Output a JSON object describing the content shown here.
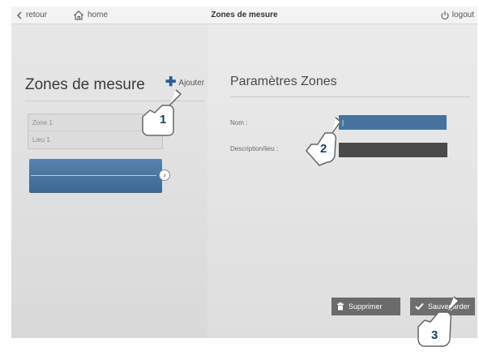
{
  "topbar": {
    "back_label": "retour",
    "home_label": "home",
    "title": "Zones de mesure",
    "logout_label": "logout"
  },
  "left": {
    "heading": "Zones de mesure",
    "add_label": "Ajouter",
    "zone": {
      "name": "Zone 1",
      "place": "Lieu 1"
    }
  },
  "right": {
    "heading": "Paramètres Zones",
    "nom_label": "Nom :",
    "nom_value": "|",
    "desc_label": "Description/lieu :",
    "desc_value": "",
    "delete_label": "Supprimer",
    "save_label": "Sauvegarder"
  },
  "callouts": [
    "1",
    "2",
    "3"
  ],
  "colors": {
    "accent": "#46739c",
    "dark_input": "#4a4a4a"
  }
}
